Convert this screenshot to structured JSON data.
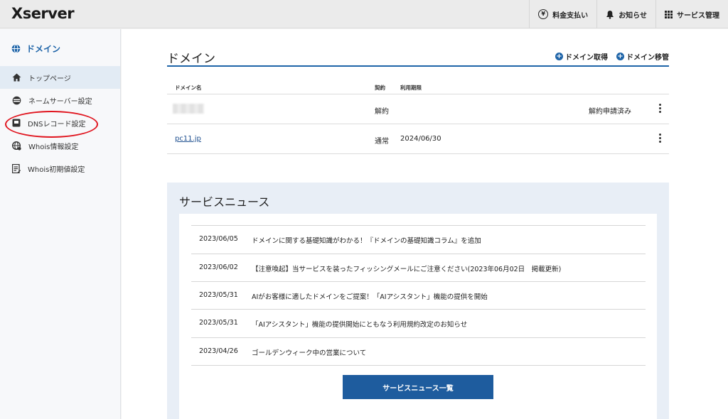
{
  "header": {
    "logo": "Xserver",
    "nav": [
      {
        "label": "料金支払い",
        "icon": "yen-icon"
      },
      {
        "label": "お知らせ",
        "icon": "bell-icon"
      },
      {
        "label": "サービス管理",
        "icon": "grid-icon"
      }
    ]
  },
  "sidebar": {
    "title": "ドメイン",
    "items": [
      {
        "label": "トップページ",
        "icon": "home-icon",
        "active": true
      },
      {
        "label": "ネームサーバー設定",
        "icon": "server-icon"
      },
      {
        "label": "DNSレコード設定",
        "icon": "record-icon"
      },
      {
        "label": "Whois情報設定",
        "icon": "globe-icon"
      },
      {
        "label": "Whois初期値設定",
        "icon": "form-icon"
      }
    ],
    "annotation_color": "#e0141e"
  },
  "main": {
    "title": "ドメイン",
    "actions": [
      {
        "label": "ドメイン取得"
      },
      {
        "label": "ドメイン移管"
      }
    ],
    "table": {
      "headers": {
        "name": "ドメイン名",
        "contract": "契約",
        "expiry": "利用期限"
      },
      "rows": [
        {
          "name": "",
          "contract": "解約",
          "expiry": "",
          "status": "解約申請済み"
        },
        {
          "name": "pc11.jp",
          "contract": "通常",
          "expiry": "2024/06/30",
          "status": ""
        }
      ]
    },
    "news": {
      "title": "サービスニュース",
      "items": [
        {
          "date": "2023/06/05",
          "text": "ドメインに関する基礎知識がわかる！『ドメインの基礎知識コラム』を追加"
        },
        {
          "date": "2023/06/02",
          "text": "【注意喚起】当サービスを装ったフィッシングメールにご注意ください(2023年06月02日　掲載更新)"
        },
        {
          "date": "2023/05/31",
          "text": "AIがお客様に適したドメインをご提案！「AIアシスタント」機能の提供を開始"
        },
        {
          "date": "2023/05/31",
          "text": "「AIアシスタント」機能の提供開始にともなう利用規約改定のお知らせ"
        },
        {
          "date": "2023/04/26",
          "text": "ゴールデンウィーク中の営業について"
        }
      ],
      "button_label": "サービスニュース一覧"
    },
    "accent_color": "#1e64a8"
  }
}
